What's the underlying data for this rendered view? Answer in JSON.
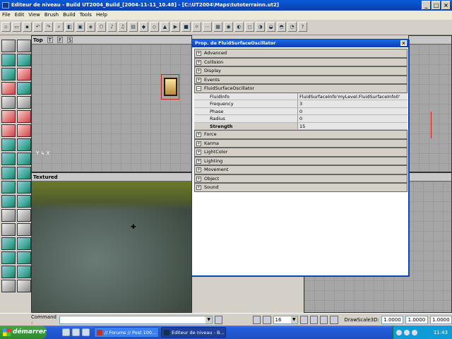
{
  "window": {
    "title": "Editeur de niveau - Build UT2004_Build_[2004-11-11_10.48] - [C:\\UT2004\\Maps\\tutoterrainn.ut2]"
  },
  "menu": [
    "File",
    "Edit",
    "View",
    "Brush",
    "Build",
    "Tools",
    "Help"
  ],
  "viewports": {
    "top_label": "Top",
    "textured_label": "Textured",
    "view_buttons": [
      "T",
      "F",
      "S"
    ]
  },
  "properties": {
    "title": "Prop. de FluidSurfaceOscillator",
    "categories_before": [
      "Advanced",
      "Collision",
      "Display",
      "Events"
    ],
    "expanded_category": "FluidSurfaceOscillator",
    "rows": [
      {
        "key": "FluidInfo",
        "value": "FluidSurfaceInfo'myLevel.FluidSurfaceInfo0'"
      },
      {
        "key": "Frequency",
        "value": "3"
      },
      {
        "key": "Phase",
        "value": "0"
      },
      {
        "key": "Radius",
        "value": "0"
      },
      {
        "key": "Strength",
        "value": "15"
      }
    ],
    "categories_after": [
      "Force",
      "Karma",
      "LightColor",
      "Lighting",
      "Movement",
      "Object",
      "Sound"
    ]
  },
  "statusbar": {
    "command_label": "Command :",
    "grid_value": "16",
    "drawscale_label": "DrawScale3D:",
    "drawscale_values": [
      "1.0000",
      "1.0000",
      "1.0000"
    ]
  },
  "taskbar": {
    "start_label": "démarrer",
    "tasks": [
      "// Forums // Post 100...",
      "Editeur de niveau - B..."
    ],
    "clock": "11:43"
  }
}
